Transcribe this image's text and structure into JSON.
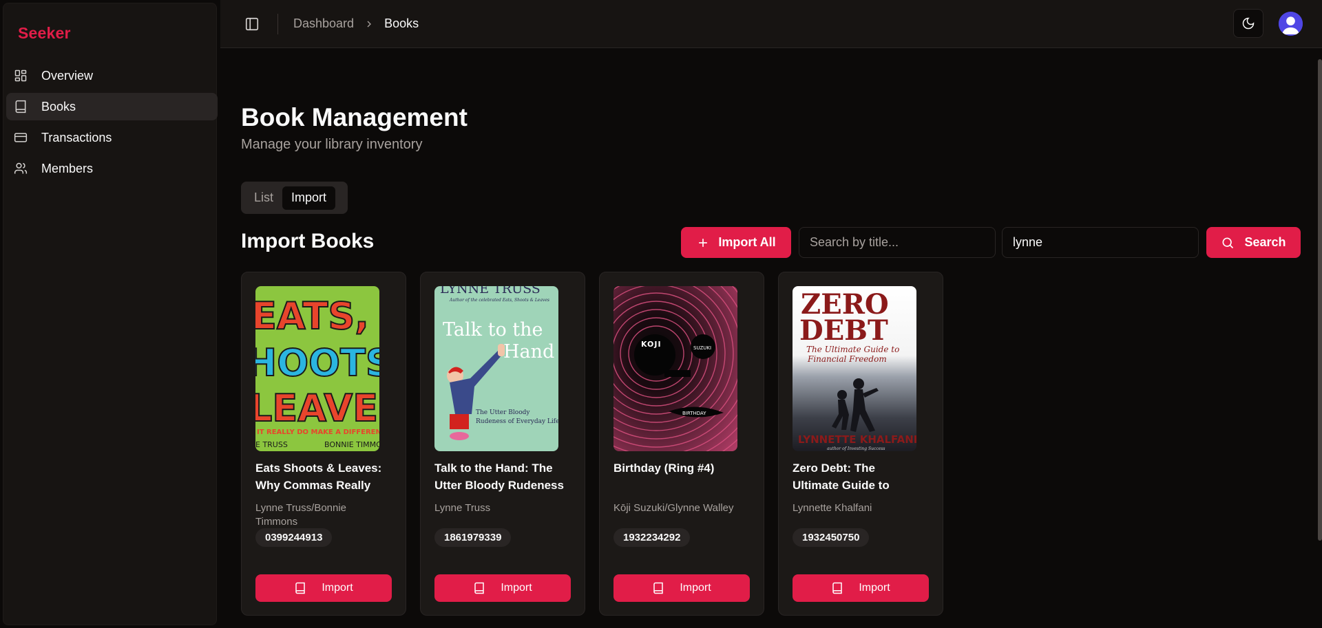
{
  "sidebar": {
    "brand": "Seeker",
    "items": [
      {
        "label": "Overview",
        "icon": "dashboard-icon"
      },
      {
        "label": "Books",
        "icon": "book-icon",
        "active": true
      },
      {
        "label": "Transactions",
        "icon": "credit-card-icon"
      },
      {
        "label": "Members",
        "icon": "users-icon"
      }
    ]
  },
  "header": {
    "breadcrumb": [
      "Dashboard",
      "Books"
    ]
  },
  "main": {
    "title": "Book Management",
    "subtitle": "Manage your library inventory",
    "tabs": [
      {
        "label": "List",
        "active": false
      },
      {
        "label": "Import",
        "active": true
      }
    ],
    "section_title": "Import Books",
    "import_all_label": "Import All",
    "search_title_placeholder": "Search by title...",
    "search_author_value": "lynne",
    "search_label": "Search"
  },
  "books": [
    {
      "title": "Eats Shoots & Leaves: Why Commas Really Do Make a Difference!",
      "author": "Lynne Truss/Bonnie Timmons",
      "isbn": "0399244913",
      "import_label": "Import",
      "cover_text": [
        "EATS,",
        "HOOTS",
        "LEAVES",
        "IT REALLY DO MAKE A DIFFERENCE",
        "E TRUSS",
        "BONNIE TIMMO"
      ]
    },
    {
      "title": "Talk to the Hand: The Utter Bloody Rudeness of Everyday Life",
      "author": "Lynne Truss",
      "isbn": "1861979339",
      "import_label": "Import",
      "cover_text": [
        "LYNNE TRUSS",
        "Author of the celebrated Eats, Shoots & Leaves",
        "Talk to the",
        "Hand",
        "The Utter Bloody",
        "Rudeness of Everyday Life"
      ]
    },
    {
      "title": "Birthday (Ring #4)",
      "author": "Kōji Suzuki/Glynne Walley",
      "isbn": "1932234292",
      "import_label": "Import",
      "cover_text": [
        "KOJI",
        "SUZUKI",
        "BIRTHDAY"
      ]
    },
    {
      "title": "Zero Debt: The Ultimate Guide to Financial Freedom",
      "author": "Lynnette Khalfani",
      "isbn": "1932450750",
      "import_label": "Import",
      "cover_text": [
        "ZERO",
        "DEBT",
        "The Ultimate Guide to",
        "Financial Freedom",
        "LYNNETTE KHALFANI",
        "author of Investing Success"
      ]
    }
  ],
  "colors": {
    "accent": "#e11d48",
    "background": "#0c0a09",
    "card": "#1c1917",
    "muted_text": "#a8a29e"
  }
}
